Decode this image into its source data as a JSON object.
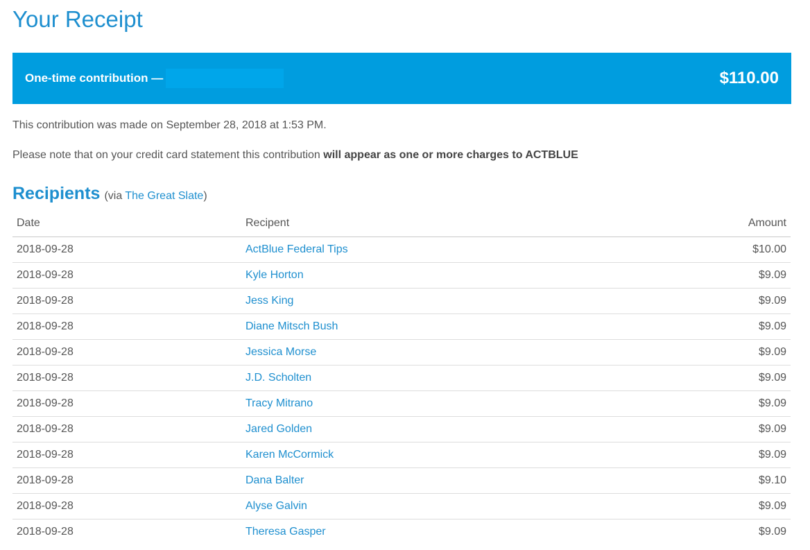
{
  "page": {
    "title": "Your Receipt"
  },
  "banner": {
    "label": "One-time contribution —",
    "amount": "$110.00"
  },
  "notes": {
    "made_on": "This contribution was made on September 28, 2018 at 1:53 PM.",
    "statement_prefix": "Please note that on your credit card statement this contribution",
    "statement_bold": "will appear as one or more charges to ACTBLUE"
  },
  "recipients": {
    "heading": "Recipients",
    "via_prefix": "(via",
    "via_link": "The Great Slate",
    "via_suffix": ")"
  },
  "table": {
    "headers": {
      "date": "Date",
      "recipient": "Recipent",
      "amount": "Amount"
    },
    "rows": [
      {
        "date": "2018-09-28",
        "recipient": "ActBlue Federal Tips",
        "amount": "$10.00"
      },
      {
        "date": "2018-09-28",
        "recipient": "Kyle Horton",
        "amount": "$9.09"
      },
      {
        "date": "2018-09-28",
        "recipient": "Jess King",
        "amount": "$9.09"
      },
      {
        "date": "2018-09-28",
        "recipient": "Diane Mitsch Bush",
        "amount": "$9.09"
      },
      {
        "date": "2018-09-28",
        "recipient": "Jessica Morse",
        "amount": "$9.09"
      },
      {
        "date": "2018-09-28",
        "recipient": "J.D. Scholten",
        "amount": "$9.09"
      },
      {
        "date": "2018-09-28",
        "recipient": "Tracy Mitrano",
        "amount": "$9.09"
      },
      {
        "date": "2018-09-28",
        "recipient": "Jared Golden",
        "amount": "$9.09"
      },
      {
        "date": "2018-09-28",
        "recipient": "Karen McCormick",
        "amount": "$9.09"
      },
      {
        "date": "2018-09-28",
        "recipient": "Dana Balter",
        "amount": "$9.10"
      },
      {
        "date": "2018-09-28",
        "recipient": "Alyse Galvin",
        "amount": "$9.09"
      },
      {
        "date": "2018-09-28",
        "recipient": "Theresa Gasper",
        "amount": "$9.09"
      }
    ]
  },
  "colors": {
    "accent": "#1e8fcf",
    "banner": "#009ddf",
    "text": "#555555"
  }
}
